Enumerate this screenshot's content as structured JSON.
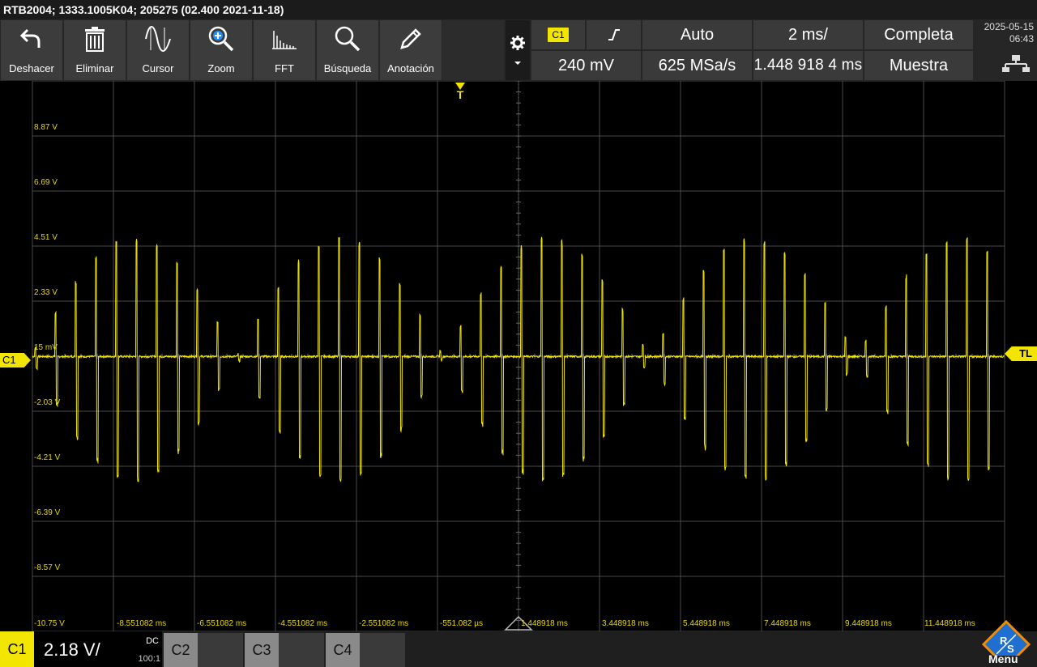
{
  "title_bar": "RTB2004; 1333.1005K04; 205275 (02.400 2021-11-18)",
  "toolbar": {
    "undo": "Deshacer",
    "delete": "Eliminar",
    "cursor": "Cursor",
    "zoom": "Zoom",
    "fft": "FFT",
    "search": "Búsqueda",
    "annotation": "Anotación"
  },
  "settings": {
    "trigger_source": "C1",
    "trigger_level": "240 mV",
    "trigger_mode": "Auto",
    "sample_rate": "625 MSa/s",
    "time_scale": "2 ms/",
    "trigger_position": "1.448 918 4 ms",
    "acq_mode": "Completa",
    "acq_type": "Muestra"
  },
  "datetime": {
    "date": "2025-05-15",
    "time": "06:43"
  },
  "y_labels": [
    "8.87 V",
    "6.69 V",
    "4.51 V",
    "2.33 V",
    "15 mV",
    "-2.03 V",
    "-4.21 V",
    "-6.39 V",
    "-8.57 V",
    "-10.75 V"
  ],
  "x_labels": [
    "-8.551082 ms",
    "-6.551082 ms",
    "-4.551082 ms",
    "-2.551082 ms",
    "-551.082 µs",
    "1.448918 ms",
    "3.448918 ms",
    "5.448918 ms",
    "7.448918 ms",
    "9.448918 ms",
    "11.448918 ms"
  ],
  "markers": {
    "channel": "C1",
    "trigger_level": "TL",
    "trigger": "T"
  },
  "channel_bar": {
    "c1_label": "C1",
    "c1_scale": "2.18 V/",
    "c1_coupling": "DC",
    "c1_probe": "100:1",
    "c2": "C2",
    "c3": "C3",
    "c4": "C4",
    "menu": "Menu"
  },
  "colors": {
    "trace": "#f2e600",
    "grid": "#4a4a4a",
    "background": "#000000"
  },
  "icons": [
    "undo-icon",
    "trash-icon",
    "cursor-icon",
    "zoom-icon",
    "fft-icon",
    "search-icon",
    "pen-icon",
    "gear-icon",
    "rising-edge-icon",
    "lan-icon",
    "rs-logo"
  ],
  "waveform": {
    "volts_per_div": 2.18,
    "offset_v": 0.015,
    "time_per_div_ms": 2,
    "pulse_period_ms": 0.5,
    "pulse_width_ms": 0.07,
    "envelope_period_ms": 5.1,
    "envelope_peak_v": 5.0,
    "noise_v": 0.08
  }
}
